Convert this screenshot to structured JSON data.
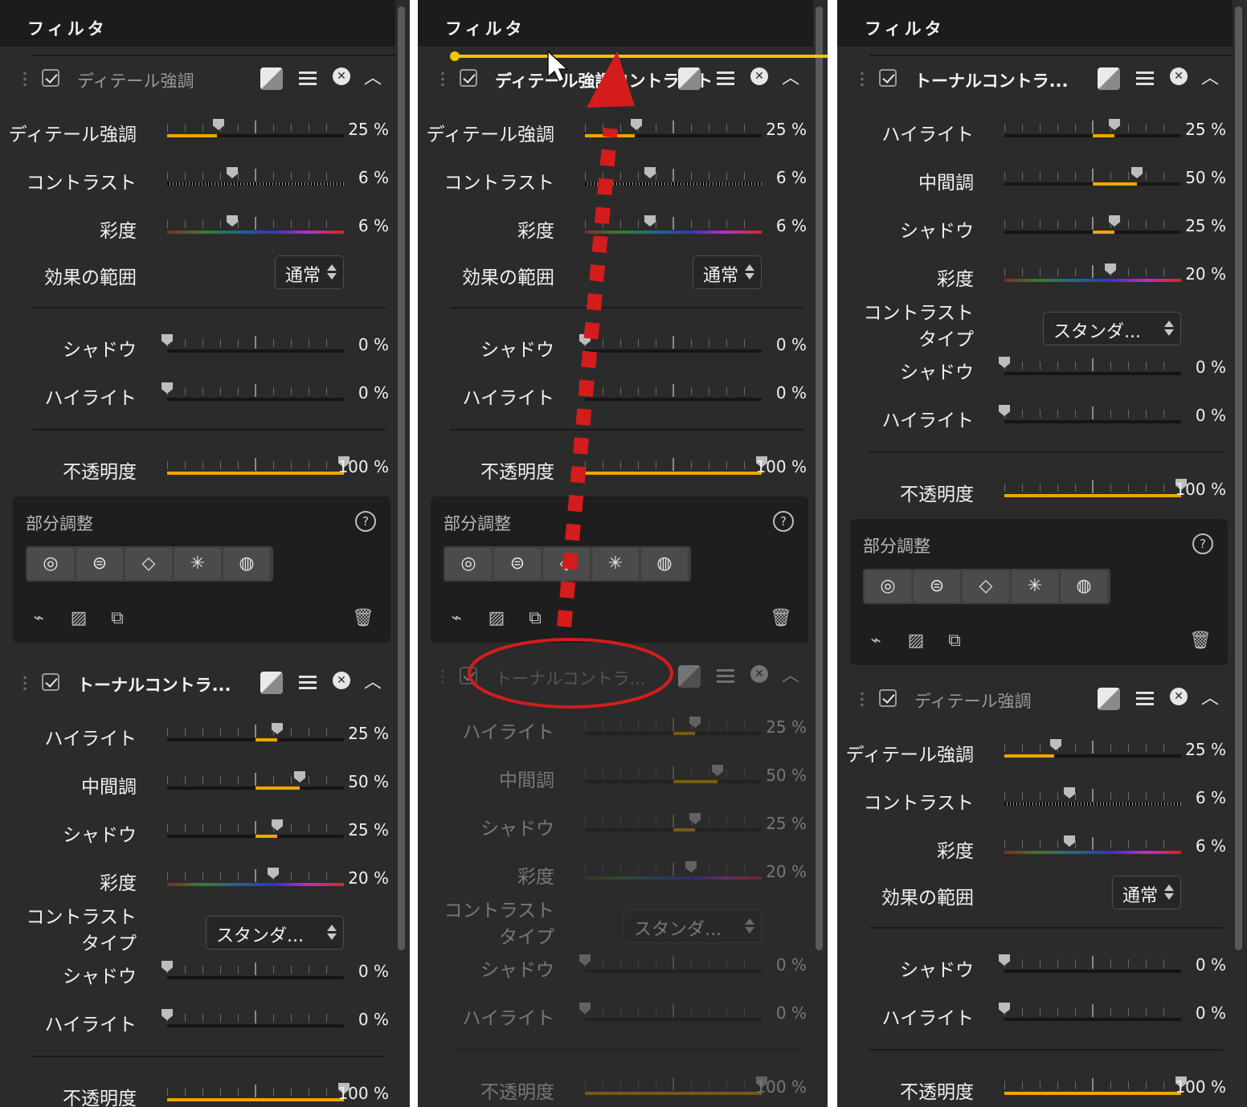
{
  "panel_title": "フィルタ",
  "detail": {
    "name": "ディテール強調",
    "rows": [
      {
        "label": "ディテール強調",
        "value": "25 %"
      },
      {
        "label": "コントラスト",
        "value": "6 %"
      },
      {
        "label": "彩度",
        "value": "6 %"
      },
      {
        "label": "効果の範囲",
        "select": "通常"
      },
      {
        "label": "シャドウ",
        "value": "0 %"
      },
      {
        "label": "ハイライト",
        "value": "0 %"
      },
      {
        "label": "不透明度",
        "value": "100 %"
      }
    ]
  },
  "tonal": {
    "name": "トーナルコントラ...",
    "rows": [
      {
        "label": "ハイライト",
        "value": "25 %"
      },
      {
        "label": "中間調",
        "value": "50 %"
      },
      {
        "label": "シャドウ",
        "value": "25 %"
      },
      {
        "label": "彩度",
        "value": "20 %"
      },
      {
        "label": "コントラスト\nタイプ",
        "select": "スタンダ..."
      },
      {
        "label": "シャドウ",
        "value": "0 %"
      },
      {
        "label": "ハイライト",
        "value": "0 %"
      },
      {
        "label": "不透明度",
        "value": "100 %"
      }
    ]
  },
  "drag_overlay_label": "ディテール強調コントラスト",
  "local_adjust": {
    "title": "部分調整",
    "help": "?",
    "tools": [
      "control-point-icon",
      "gradient-point-icon",
      "polygon-icon",
      "brush-point-icon",
      "pen-icon"
    ]
  },
  "colors": {
    "accent": "#f0a500",
    "annotation": "#d41c1c",
    "panel": "#2b2b2b"
  }
}
